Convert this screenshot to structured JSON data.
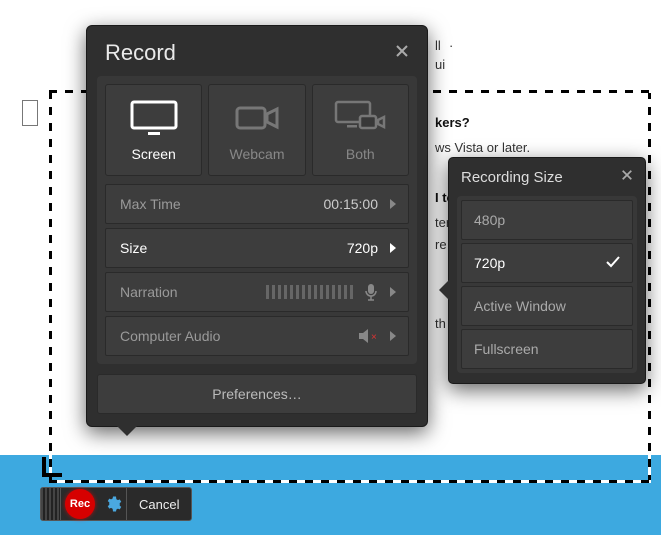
{
  "panel": {
    "title": "Record",
    "tabs": {
      "screen": "Screen",
      "webcam": "Webcam",
      "both": "Both"
    },
    "rows": {
      "maxtime_label": "Max Time",
      "maxtime_value": "00:15:00",
      "size_label": "Size",
      "size_value": "720p",
      "narration_label": "Narration",
      "audio_label": "Computer Audio"
    },
    "preferences": "Preferences…"
  },
  "flyout": {
    "title": "Recording Size",
    "options": [
      "480p",
      "720p",
      "Active Window",
      "Fullscreen"
    ],
    "selected": "720p"
  },
  "toolbar": {
    "rec": "Rec",
    "cancel": "Cancel"
  },
  "background": {
    "t1": "ll",
    "t2": "ui",
    "q1": "kers?",
    "a1": "ws Vista or later.",
    "q2": "I to",
    "a2": "ter",
    "a3": "re",
    "a4": "th"
  }
}
